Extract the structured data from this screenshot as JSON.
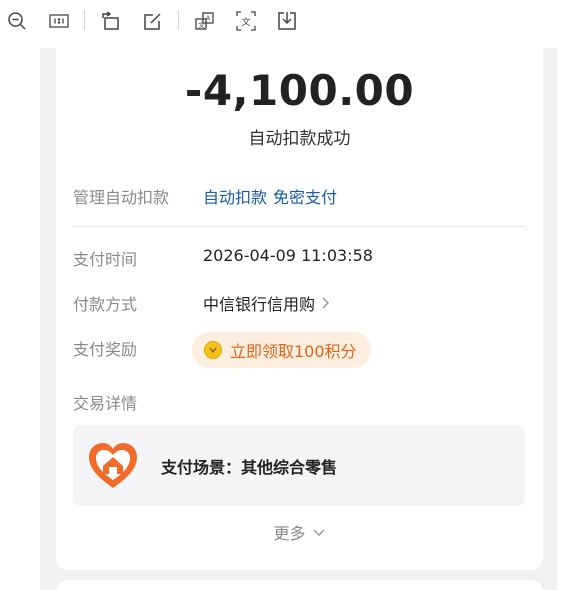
{
  "toolbar": {
    "buttons": [
      {
        "name": "zoom-out-icon"
      },
      {
        "name": "actual-size-icon",
        "text": "1:1"
      },
      {
        "name": "rotate-icon"
      },
      {
        "name": "edit-icon"
      },
      {
        "name": "image-translate-icon"
      },
      {
        "name": "text-extract-icon"
      },
      {
        "name": "download-icon"
      }
    ]
  },
  "transaction": {
    "amount": "-4,100.00",
    "status": "自动扣款成功",
    "manage_label": "管理自动扣款",
    "manage_link_1": "自动扣款",
    "manage_link_2": "免密支付",
    "time_label": "支付时间",
    "time_value": "2026-04-09 11:03:58",
    "method_label": "付款方式",
    "method_value": "中信银行信用购",
    "reward_label": "支付奖励",
    "reward_value": "立即领取100积分",
    "details_label": "交易详情",
    "scene_value": "支付场景：其他综合零售",
    "more_label": "更多"
  },
  "colors": {
    "accent_link": "#1a5ca8",
    "reward_text": "#e0661b",
    "reward_bg": "#fdeee0",
    "logo": "#f26b2a"
  }
}
